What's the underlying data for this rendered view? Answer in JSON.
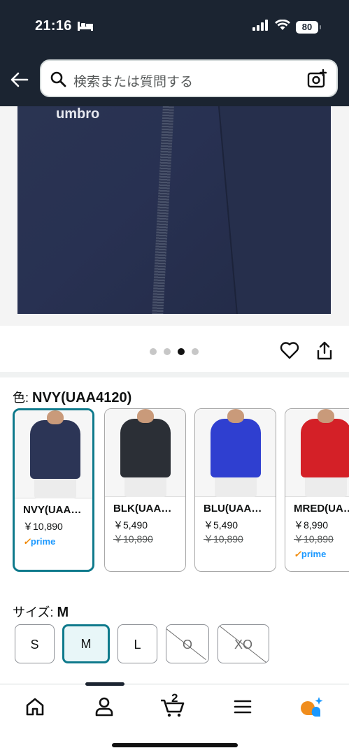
{
  "status": {
    "time": "21:16",
    "battery": "80"
  },
  "search": {
    "placeholder": "検索または質問する"
  },
  "product": {
    "brand": "umbro",
    "image_count": 4,
    "active_image_index": 2
  },
  "color": {
    "label": "色: ",
    "selected": "NVY(UAA4120)",
    "options": [
      {
        "name": "NVY(UAA…",
        "price": "￥10,890",
        "old_price": "",
        "prime": true,
        "jacket_color": "#2c3556"
      },
      {
        "name": "BLK(UAA…",
        "price": "￥5,490",
        "old_price": "￥10,890",
        "prime": false,
        "jacket_color": "#2b2f36"
      },
      {
        "name": "BLU(UAA…",
        "price": "￥5,490",
        "old_price": "￥10,890",
        "prime": false,
        "jacket_color": "#2f3fd0"
      },
      {
        "name": "MRED(UA…",
        "price": "￥8,990",
        "old_price": "￥10,890",
        "prime": true,
        "jacket_color": "#d42027"
      }
    ],
    "prime_label": "prime",
    "prime_check": "✓"
  },
  "size": {
    "label": "サイズ: ",
    "selected": "M",
    "options": [
      "S",
      "M",
      "L",
      "O",
      "XO"
    ]
  },
  "bottom_nav": {
    "cart_count": "2"
  }
}
